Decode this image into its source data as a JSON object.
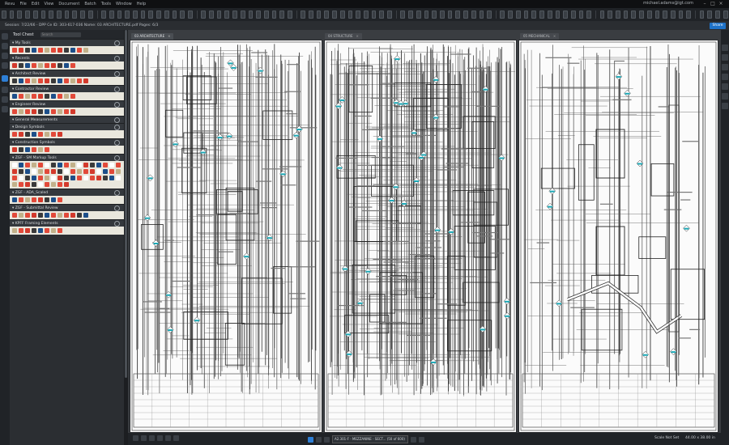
{
  "menu": [
    "Revu",
    "File",
    "Edit",
    "View",
    "Document",
    "Batch",
    "Tools",
    "Window",
    "Help"
  ],
  "user": {
    "email": "michael.adams@igt.com"
  },
  "session": {
    "text": "Session: 7/22/66 - DPP Ce ID: 303-617-036 Name: 03 ARCHITECTURE.pdf Pages: 6/3"
  },
  "share_label": "Share",
  "toolchest": {
    "title": "Tool Chest",
    "search_placeholder": "Search",
    "sections": [
      {
        "title": "My Tools",
        "tools": 12
      },
      {
        "title": "Recents",
        "tools": 10
      },
      {
        "title": "Architect Review",
        "tools": 12
      },
      {
        "title": "Contractor Review",
        "tools": 10
      },
      {
        "title": "Engineer Review",
        "tools": 10
      },
      {
        "title": "General Measurements",
        "tools": 0
      },
      {
        "title": "Design Symbols",
        "tools": 8
      },
      {
        "title": "Construction Symbols",
        "tools": 6
      },
      {
        "title": "ZGF - SM Markup Tools",
        "tools": 60
      },
      {
        "title": "ZGF - ADA_Scaled",
        "tools": 8
      },
      {
        "title": "ZGF - Submittal Review",
        "tools": 12
      },
      {
        "title": "KPFF Framing Elements",
        "tools": 8
      }
    ]
  },
  "tabs": [
    {
      "label": "03 ARCHITECTURE"
    },
    {
      "label": "04 STRUCTURE"
    },
    {
      "label": "05 MECHANICAL"
    }
  ],
  "statusbar": {
    "page_select": "A2.301-F - MEZZANINE - SECT... (50 of 600)",
    "scale": "Scale Not Set",
    "dims": "44.00 x 38.00 in"
  },
  "colors": {
    "accent": "#1e72c8",
    "marker": "#1aa7b5",
    "toolred": "#e24a3a"
  }
}
